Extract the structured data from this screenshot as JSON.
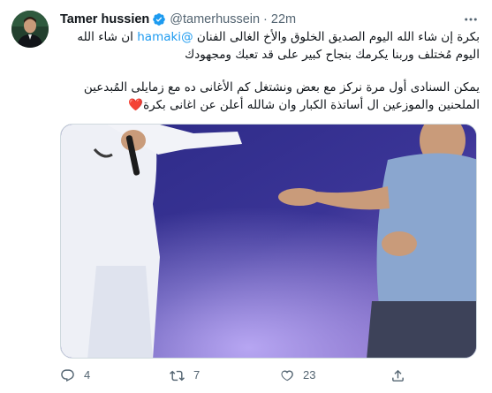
{
  "author": {
    "display_name": "Tamer hussien",
    "handle": "@tamerhussein",
    "separator": "·",
    "time": "22m",
    "verified": true
  },
  "tweet": {
    "p1_part1": "بكرة إن شاء الله اليوم الصديق الخلوق والأخ الغالى الفنان ",
    "mention": "@hamaki",
    "p1_part2": " ان شاء الله اليوم مُختلف وربنا يكرمك بنجاح كبير على قد تعبك ومجهودك",
    "p2_text": "يمكن السنادى أول مرة نركز مع بعض ونشتغل كم الأغانى ده مع زمايلى المُبدعين الملحنين والموزعين ال أساتذة الكبار وان شالله أعلن عن اغانى بكرة",
    "heart": "❤️"
  },
  "actions": {
    "reply_count": "4",
    "retweet_count": "7",
    "like_count": "23"
  },
  "icons": {
    "more": "more-icon",
    "verified": "verified-badge-icon",
    "reply": "reply-icon",
    "retweet": "retweet-icon",
    "like": "heart-icon",
    "share": "share-icon"
  },
  "colors": {
    "text": "#0f1419",
    "secondary": "#536471",
    "accent": "#1d9bf0",
    "heart": "#f91880"
  }
}
